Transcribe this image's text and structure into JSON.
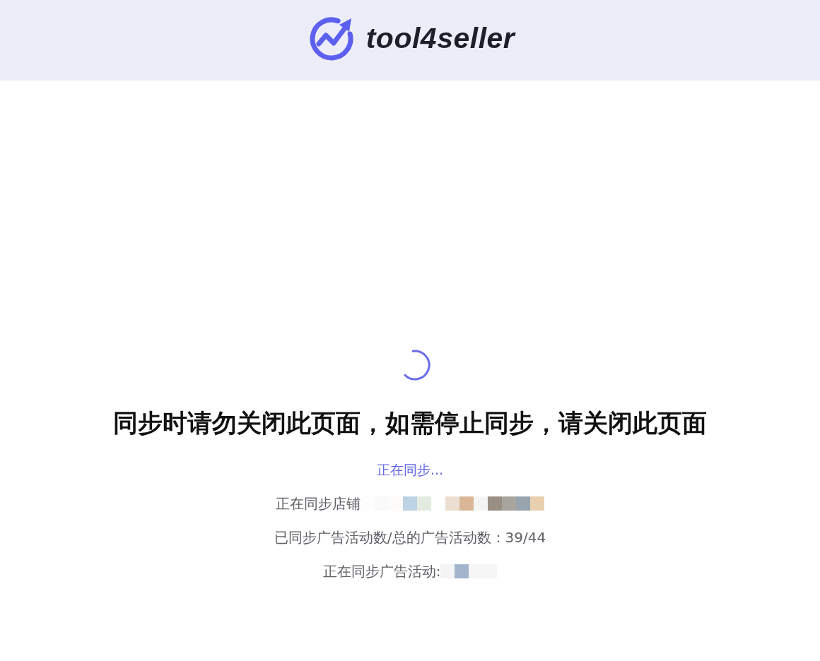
{
  "header": {
    "logo_text": "tool4seller"
  },
  "heading": "同步时请勿关闭此页面，如需停止同步，请关闭此页面",
  "status": "正在同步...",
  "details": [
    {
      "text": "正在同步店铺",
      "redacted": true
    },
    {
      "text": "已同步广告活动数/总的广告活动数：39/44",
      "redacted": false
    },
    {
      "text": "正在同步广告活动:",
      "redacted": true
    }
  ]
}
